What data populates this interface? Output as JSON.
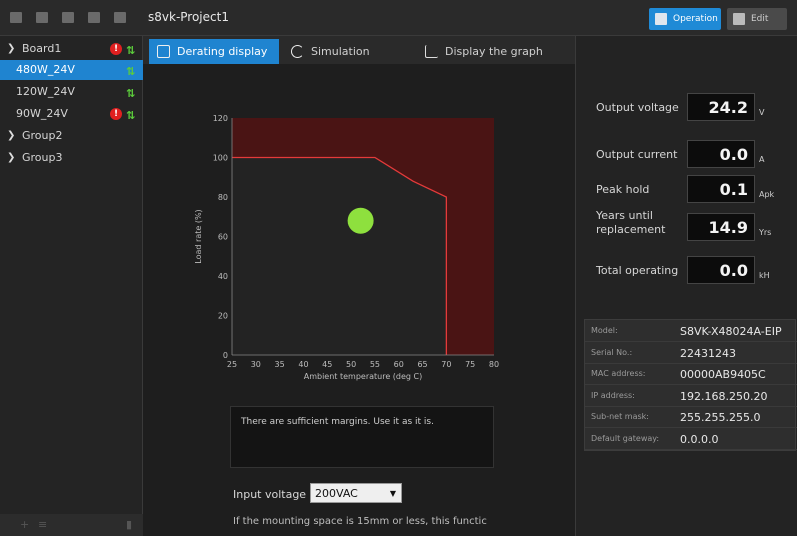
{
  "app": {
    "project_title": "s8vk-Project1",
    "mode_operation": "Operation",
    "mode_edit": "Edit"
  },
  "sidebar": {
    "board": "Board1",
    "items": [
      {
        "label": "480W_24V",
        "selected": true,
        "error": false
      },
      {
        "label": "120W_24V",
        "selected": false,
        "error": false
      },
      {
        "label": "90W_24V",
        "selected": false,
        "error": true
      }
    ],
    "groups": [
      "Group2",
      "Group3"
    ]
  },
  "tabs": [
    "Derating display",
    "Simulation",
    "Display the graph"
  ],
  "chart_data": {
    "type": "area",
    "xlabel": "Ambient temperature (deg C)",
    "ylabel": "Load rate (%)",
    "xlim": [
      25,
      80
    ],
    "ylim": [
      0,
      120
    ],
    "xticks": [
      25,
      30,
      35,
      40,
      45,
      50,
      55,
      60,
      65,
      70,
      75,
      80
    ],
    "yticks": [
      0,
      20,
      40,
      60,
      80,
      100,
      120
    ],
    "derating_curve": {
      "x": [
        25,
        55,
        63,
        70,
        70
      ],
      "y": [
        100,
        100,
        88,
        80,
        0
      ]
    },
    "operating_point": {
      "x": 52,
      "y": 68
    },
    "colors": {
      "safe": "#232323",
      "danger": "#4a1414",
      "curve": "#e43a3a",
      "point": "#8ee03e"
    }
  },
  "message": "There are sufficient margins.  Use it as it is.",
  "input_voltage": {
    "label": "Input voltage",
    "value": "200VAC"
  },
  "note": "If the mounting space is 15mm or less, this functic",
  "metrics": [
    {
      "label": "Output voltage",
      "value": "24.2",
      "unit": "V"
    },
    {
      "label": "Output current",
      "value": "0.0",
      "unit": "A"
    },
    {
      "label": "Peak hold",
      "value": "0.1",
      "unit": "Apk"
    },
    {
      "label": "Years until replacement",
      "value": "14.9",
      "unit": "Yrs"
    },
    {
      "label": "Total operating",
      "value": "0.0",
      "unit": "kH"
    }
  ],
  "device_info": [
    {
      "key": "Model:",
      "value": "S8VK-X48024A-EIP"
    },
    {
      "key": "Serial No.:",
      "value": "22431243"
    },
    {
      "key": "MAC address:",
      "value": "00000AB9405C"
    },
    {
      "key": "IP address:",
      "value": "192.168.250.20"
    },
    {
      "key": "Sub-net mask:",
      "value": "255.255.255.0"
    },
    {
      "key": "Default gateway:",
      "value": "0.0.0.0"
    }
  ]
}
